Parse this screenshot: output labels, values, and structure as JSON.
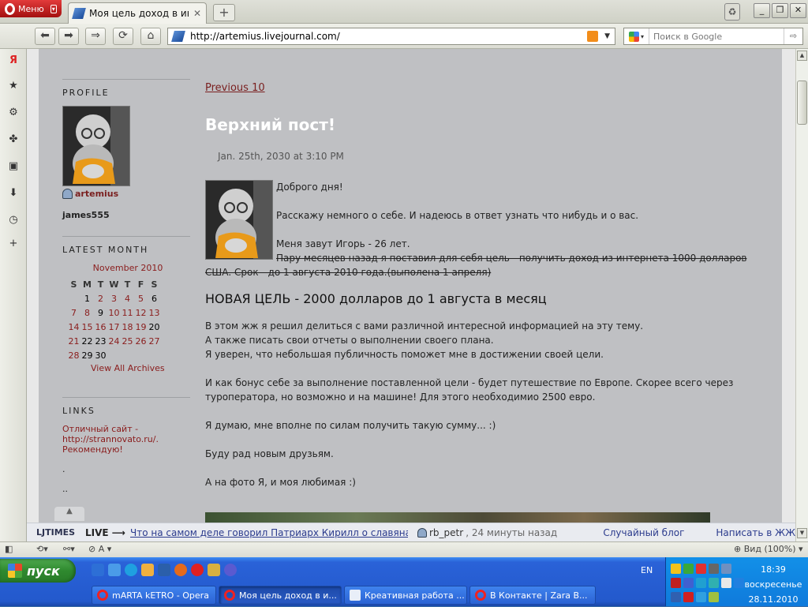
{
  "browser": {
    "menu_label": "Меню",
    "tab_title": "Моя цель доход в инте...",
    "url": "http://artemius.livejournal.com/",
    "search_placeholder": "Поиск в Google",
    "zoom": "Вид (100%)"
  },
  "sidebar": {
    "profile_heading": "PROFILE",
    "username": "artemius",
    "username2": "james555",
    "latest_heading": "LATEST MONTH",
    "month": "November 2010",
    "weekdays": [
      "S",
      "M",
      "T",
      "W",
      "T",
      "F",
      "S"
    ],
    "calendar_rows": [
      [
        "",
        "1",
        "2",
        "3",
        "4",
        "5",
        "6"
      ],
      [
        "7",
        "8",
        "9",
        "10",
        "11",
        "12",
        "13"
      ],
      [
        "14",
        "15",
        "16",
        "17",
        "18",
        "19",
        "20"
      ],
      [
        "21",
        "22",
        "23",
        "24",
        "25",
        "26",
        "27"
      ],
      [
        "28",
        "29",
        "30",
        "",
        "",
        "",
        ""
      ]
    ],
    "view_archives": "View All Archives",
    "links_heading": "LINKS",
    "link_text": "Отличный сайт - http://strannovato.ru/. Рекомендую!",
    "dots": [
      ".",
      "..",
      "..."
    ]
  },
  "post": {
    "previous": "Previous 10",
    "title": "Верхний пост!",
    "date": "Jan. 25th, 2030 at 3:10 PM",
    "greeting": "Доброго дня!",
    "p1": "Расскажу немного о себе. И надеюсь в ответ узнать что нибудь и о вас.",
    "p2": "Меня завут Игорь - 26 лет.",
    "strike": "Пару месяцев назад я поставил для себя цель - получить доход из интернета 1000 долларов США. Срок - до 1 августа 2010 года.(выполена 1 апреля)",
    "goal": "НОВАЯ ЦЕЛЬ - 2000 долларов до 1 августа в месяц",
    "p3a": "В этом жж я решил делиться с вами различной интересной информацией на эту тему.",
    "p3b": "А также писать свои отчеты о выполнении своего плана.",
    "p3c": "Я уверен, что небольшая публичность поможет мне в достижении своей цели.",
    "p4": "И как бонус себе за выполнение поставленной цели - будет путешествие по Европе. Скорее всего через туроператора, но возможно и на машине! Для этого необходимио 2500 евро.",
    "p5": "Я думаю, мне вполне по силам получить такую сумму... :)",
    "p6": "Буду рад новым друзьям.",
    "p7": "А на фото Я, и моя любимая :)"
  },
  "ljtimes": {
    "logo": "LJTIMES",
    "live": "LIVE ⟶",
    "headline": "Что на самом деле говорил Патриарх Кирилл о славянах...",
    "user": "rb_petr",
    "when": ", 24 минуты назад",
    "random": "Случайный блог",
    "write": "Написать в ЖЖ"
  },
  "taskbar": {
    "start": "пуск",
    "lang": "EN",
    "time": "18:39",
    "day": "воскресенье",
    "date": "28.11.2010",
    "tasks": [
      "mARTA kETRO - Opera",
      "Моя цель доход в и...",
      "Креативная работа ...",
      "В Контакте | Zara B..."
    ]
  },
  "colors": {
    "accent": "#8a1c1c",
    "page_bg": "#bfc0c3",
    "title": "#ffffff"
  }
}
